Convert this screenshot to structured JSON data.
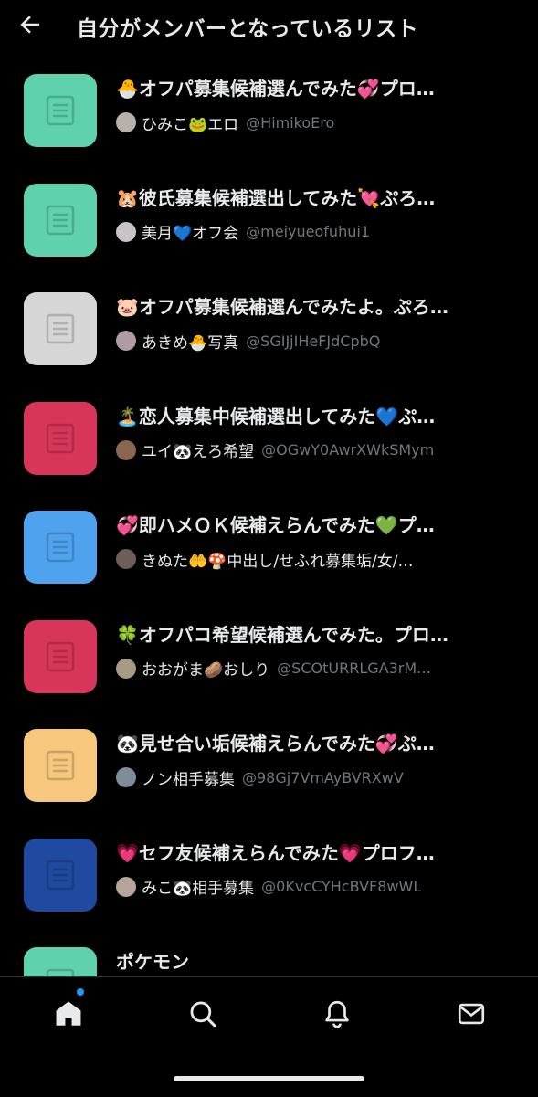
{
  "header": {
    "title": "自分がメンバーとなっているリスト",
    "back_icon": "arrow-left-icon"
  },
  "lists": [
    {
      "title": "🐣オフパ募集候補選んでみた💞プロ…",
      "owner_name": "ひみこ🐸エロ",
      "owner_handle": "@HimikoEro",
      "color": "#5fd1ad",
      "avatar_color": "#b8b0aa"
    },
    {
      "title": "🐹彼氏募集候補選出してみた💘ぷろ…",
      "owner_name": "美月💙オフ会",
      "owner_handle": "@meiyueofuhui1",
      "color": "#5fd1ad",
      "avatar_color": "#c9c2c8"
    },
    {
      "title": "🐷オフパ募集候補選んでみたよ。ぷろ…",
      "owner_name": "あきめ🐣写真",
      "owner_handle": "@SGIJjIHeFJdCpbQ",
      "color": "#d6d6d6",
      "avatar_color": "#b09aa6"
    },
    {
      "title": "🏝️恋人募集中候補選出してみた💙ぷ…",
      "owner_name": "ユイ🐼えろ希望",
      "owner_handle": "@OGwY0AwrXWkSMym",
      "color": "#d8355a",
      "avatar_color": "#8a6652"
    },
    {
      "title": "💞即ハメＯＫ候補えらんでみた💚プ…",
      "owner_name": "きぬた🤲🍄中出し/せふれ募集垢/女/…",
      "owner_handle": "",
      "color": "#4fa3ee",
      "avatar_color": "#6e5e5a"
    },
    {
      "title": "🍀オフパコ希望候補選んでみた。プロ…",
      "owner_name": "おおがま🥔おしり",
      "owner_handle": "@SCOtURRLGA3rM…",
      "color": "#d8355a",
      "avatar_color": "#a79a84"
    },
    {
      "title": "🐼見せ合い垢候補えらんでみた💞ぷ…",
      "owner_name": "ノン相手募集",
      "owner_handle": "@98Gj7VmAyBVRXwV",
      "color": "#f6c77c",
      "avatar_color": "#7f8c99"
    },
    {
      "title": "💗セフ友候補えらんでみた💗プロフ…",
      "owner_name": "みこ🐼相手募集",
      "owner_handle": "@0KvcCYHcBVF8wWL",
      "color": "#1f4aa0",
      "avatar_color": "#b7a49a"
    },
    {
      "title": "ポケモン",
      "owner_name": "",
      "owner_handle": "",
      "color": "#5fd1ad",
      "avatar_color": "#000000"
    }
  ],
  "tabbar": {
    "tabs": [
      {
        "name": "home",
        "icon": "home-icon",
        "active": true,
        "has_notification_dot": true
      },
      {
        "name": "search",
        "icon": "search-icon",
        "active": false
      },
      {
        "name": "notifications",
        "icon": "bell-icon",
        "active": false
      },
      {
        "name": "messages",
        "icon": "mail-icon",
        "active": false
      }
    ],
    "dot_color": "#1d9bf0"
  }
}
